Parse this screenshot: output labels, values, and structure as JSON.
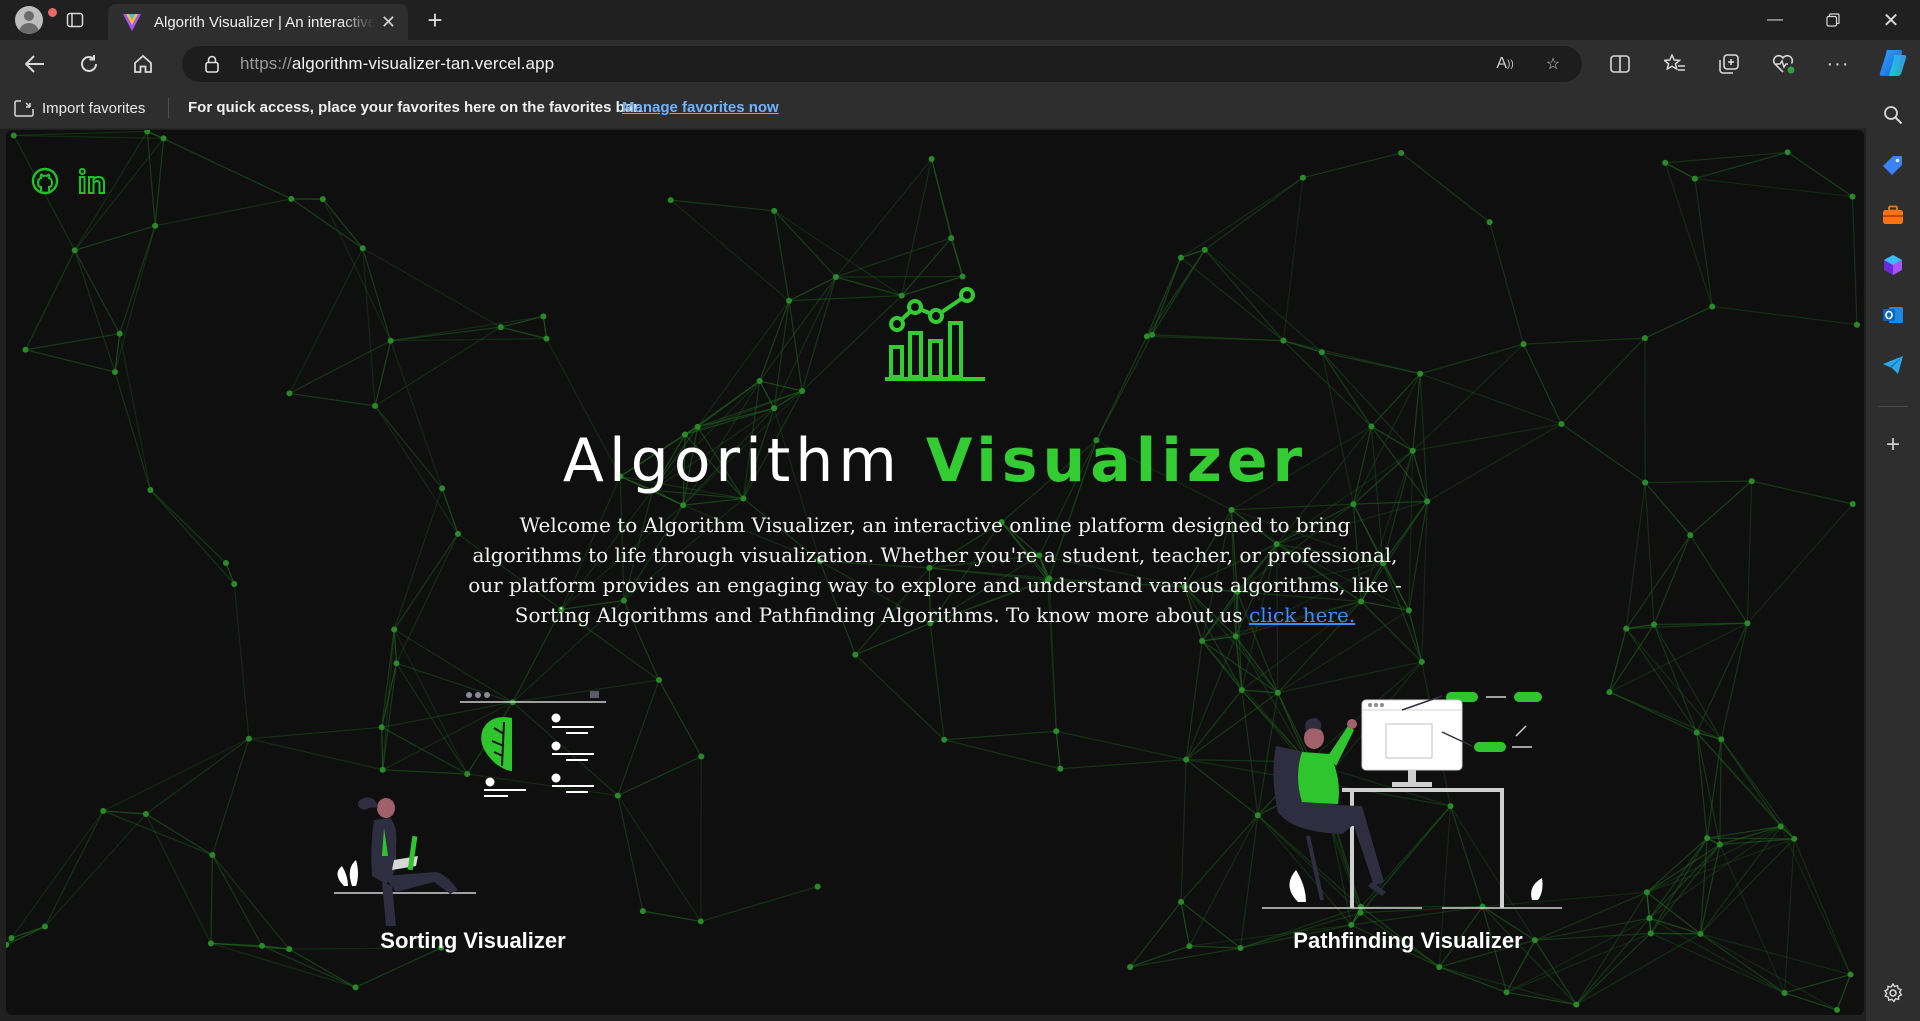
{
  "browser": {
    "tab_title": "Algorith Visualizer | An interactive online platform",
    "url_protocol": "https://",
    "url_host": "algorithm-visualizer-tan.vercel.app",
    "favorites_bar": {
      "import_label": "Import favorites",
      "message": "For quick access, place your favorites here on the favorites bar.",
      "manage_link": "Manage favorites now"
    }
  },
  "page": {
    "title_word1": "Algorithm",
    "title_word2": "Visualizer",
    "intro_text": "Welcome to Algorithm Visualizer, an interactive online platform designed to bring algorithms to life through visualization. Whether you're a student, teacher, or professional, our platform provides an engaging way to explore and understand various algorithms, like - Sorting Algorithms and Pathfinding Algorithms. To know more about us",
    "intro_link": "click here.",
    "cards": [
      {
        "label": "Sorting Visualizer"
      },
      {
        "label": "Pathfinding Visualizer"
      }
    ],
    "social": [
      "github-icon",
      "linkedin-icon"
    ]
  },
  "colors": {
    "accent_green": "#33cc33",
    "network_line": "#1f6e1f",
    "background": "#0f0f0f",
    "link_blue": "#3b8cff"
  }
}
